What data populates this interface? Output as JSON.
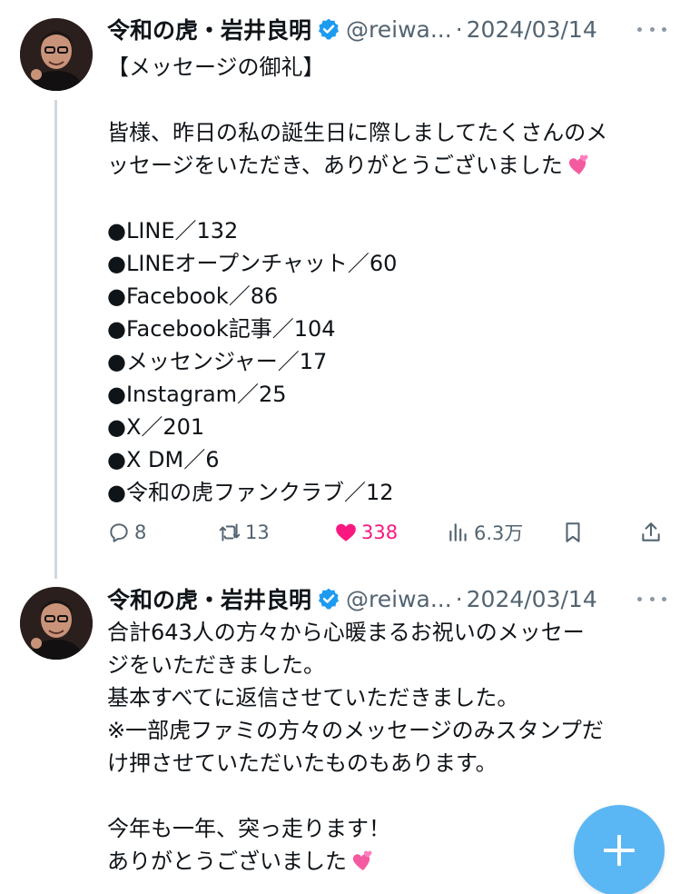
{
  "colors": {
    "text": "#0f1419",
    "secondary": "#536471",
    "like_pink": "#f91880",
    "verified_blue": "#1d9bf0",
    "fab_blue": "#1d9bf0",
    "thread_line": "#cfd9de"
  },
  "tweets": [
    {
      "author_name": "令和の虎・岩井良明",
      "handle": "@reiwa...",
      "separator": "·",
      "date": "2024/03/14",
      "lines": [
        "【メッセージの御礼】",
        "",
        "皆様、昨日の私の誕生日に際しましてたくさんのメ",
        "ッセージをいただき、ありがとうございました",
        "",
        "●LINE／132",
        "●LINEオープンチャット／60",
        "●Facebook／86",
        "●Facebook記事／104",
        "●メッセンジャー／17",
        "●Instagram／25",
        "●X／201",
        "●X DM／6",
        "●令和の虎ファンクラブ／12"
      ],
      "actions": {
        "reply_icon": "reply-icon",
        "reply_count": "8",
        "retweet_icon": "retweet-icon",
        "retweet_count": "13",
        "like_icon": "heart-filled-icon",
        "like_count": "338",
        "views_icon": "views-chart-icon",
        "views_count": "6.3万",
        "bookmark_icon": "bookmark-icon",
        "share_icon": "share-icon"
      }
    },
    {
      "author_name": "令和の虎・岩井良明",
      "handle": "@reiwa...",
      "separator": "·",
      "date": "2024/03/14",
      "lines": [
        "合計643人の方々から心暖まるお祝いのメッセー",
        "ジをいただきました。",
        "基本すべてに返信させていただきました。",
        "※一部虎ファミの方々のメッセージのみスタンプだ",
        "け押させていただいたものもあります。",
        "",
        "今年も一年、突っ走ります！",
        "ありがとうございました"
      ]
    }
  ],
  "fab": {
    "icon": "plus-icon"
  }
}
